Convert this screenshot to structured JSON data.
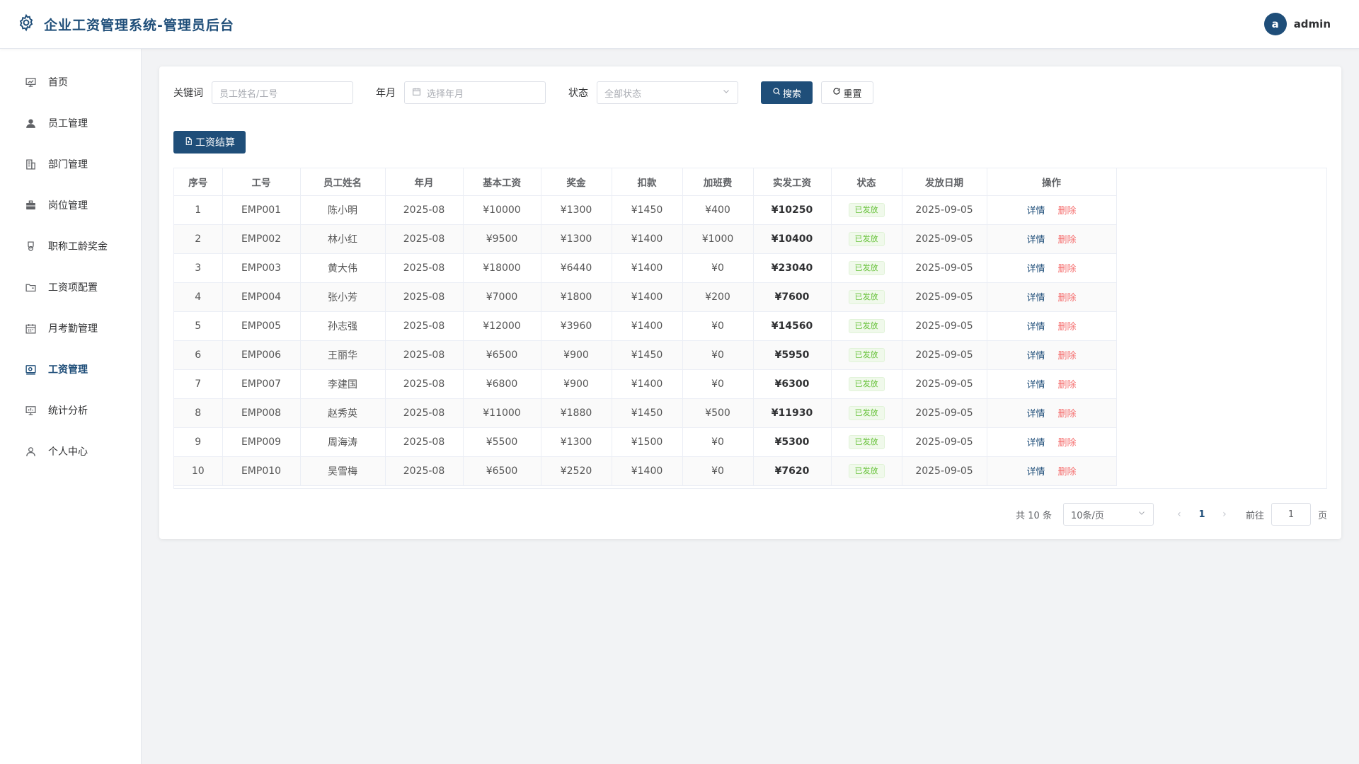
{
  "header": {
    "title": "企业工资管理系统-管理员后台",
    "avatar_letter": "a",
    "username": "admin"
  },
  "sidebar": {
    "items": [
      {
        "label": "首页",
        "icon": "dashboard-icon"
      },
      {
        "label": "员工管理",
        "icon": "user-icon"
      },
      {
        "label": "部门管理",
        "icon": "building-icon"
      },
      {
        "label": "岗位管理",
        "icon": "briefcase-icon"
      },
      {
        "label": "职称工龄奖金",
        "icon": "medal-icon"
      },
      {
        "label": "工资项配置",
        "icon": "folder-icon"
      },
      {
        "label": "月考勤管理",
        "icon": "calendar-icon"
      },
      {
        "label": "工资管理",
        "icon": "wallet-icon",
        "active": true
      },
      {
        "label": "统计分析",
        "icon": "chart-icon"
      },
      {
        "label": "个人中心",
        "icon": "person-icon"
      }
    ]
  },
  "filters": {
    "keyword_label": "关键词",
    "keyword_placeholder": "员工姓名/工号",
    "month_label": "年月",
    "month_placeholder": "选择年月",
    "status_label": "状态",
    "status_placeholder": "全部状态",
    "search_label": "搜索",
    "reset_label": "重置"
  },
  "actions": {
    "settle_label": "工资结算"
  },
  "table": {
    "columns": [
      "序号",
      "工号",
      "员工姓名",
      "年月",
      "基本工资",
      "奖金",
      "扣款",
      "加班费",
      "实发工资",
      "状态",
      "发放日期",
      "操作"
    ],
    "detail_label": "详情",
    "delete_label": "删除",
    "rows": [
      {
        "idx": "1",
        "emp_no": "EMP001",
        "name": "陈小明",
        "month": "2025-08",
        "base": "¥10000",
        "bonus": "¥1300",
        "deduct": "¥1450",
        "overtime": "¥400",
        "net": "¥10250",
        "status": "已发放",
        "pay_date": "2025-09-05"
      },
      {
        "idx": "2",
        "emp_no": "EMP002",
        "name": "林小红",
        "month": "2025-08",
        "base": "¥9500",
        "bonus": "¥1300",
        "deduct": "¥1400",
        "overtime": "¥1000",
        "net": "¥10400",
        "status": "已发放",
        "pay_date": "2025-09-05"
      },
      {
        "idx": "3",
        "emp_no": "EMP003",
        "name": "黄大伟",
        "month": "2025-08",
        "base": "¥18000",
        "bonus": "¥6440",
        "deduct": "¥1400",
        "overtime": "¥0",
        "net": "¥23040",
        "status": "已发放",
        "pay_date": "2025-09-05"
      },
      {
        "idx": "4",
        "emp_no": "EMP004",
        "name": "张小芳",
        "month": "2025-08",
        "base": "¥7000",
        "bonus": "¥1800",
        "deduct": "¥1400",
        "overtime": "¥200",
        "net": "¥7600",
        "status": "已发放",
        "pay_date": "2025-09-05"
      },
      {
        "idx": "5",
        "emp_no": "EMP005",
        "name": "孙志强",
        "month": "2025-08",
        "base": "¥12000",
        "bonus": "¥3960",
        "deduct": "¥1400",
        "overtime": "¥0",
        "net": "¥14560",
        "status": "已发放",
        "pay_date": "2025-09-05"
      },
      {
        "idx": "6",
        "emp_no": "EMP006",
        "name": "王丽华",
        "month": "2025-08",
        "base": "¥6500",
        "bonus": "¥900",
        "deduct": "¥1450",
        "overtime": "¥0",
        "net": "¥5950",
        "status": "已发放",
        "pay_date": "2025-09-05"
      },
      {
        "idx": "7",
        "emp_no": "EMP007",
        "name": "李建国",
        "month": "2025-08",
        "base": "¥6800",
        "bonus": "¥900",
        "deduct": "¥1400",
        "overtime": "¥0",
        "net": "¥6300",
        "status": "已发放",
        "pay_date": "2025-09-05"
      },
      {
        "idx": "8",
        "emp_no": "EMP008",
        "name": "赵秀英",
        "month": "2025-08",
        "base": "¥11000",
        "bonus": "¥1880",
        "deduct": "¥1450",
        "overtime": "¥500",
        "net": "¥11930",
        "status": "已发放",
        "pay_date": "2025-09-05"
      },
      {
        "idx": "9",
        "emp_no": "EMP009",
        "name": "周海涛",
        "month": "2025-08",
        "base": "¥5500",
        "bonus": "¥1300",
        "deduct": "¥1500",
        "overtime": "¥0",
        "net": "¥5300",
        "status": "已发放",
        "pay_date": "2025-09-05"
      },
      {
        "idx": "10",
        "emp_no": "EMP010",
        "name": "吴雪梅",
        "month": "2025-08",
        "base": "¥6500",
        "bonus": "¥2520",
        "deduct": "¥1400",
        "overtime": "¥0",
        "net": "¥7620",
        "status": "已发放",
        "pay_date": "2025-09-05"
      }
    ]
  },
  "pagination": {
    "total_text": "共 10 条",
    "page_size": "10条/页",
    "current_page": "1",
    "goto_label": "前往",
    "goto_value": "1",
    "page_suffix": "页"
  },
  "colors": {
    "primary": "#1f4e79",
    "danger": "#f56c6c",
    "success": "#67c23a"
  }
}
